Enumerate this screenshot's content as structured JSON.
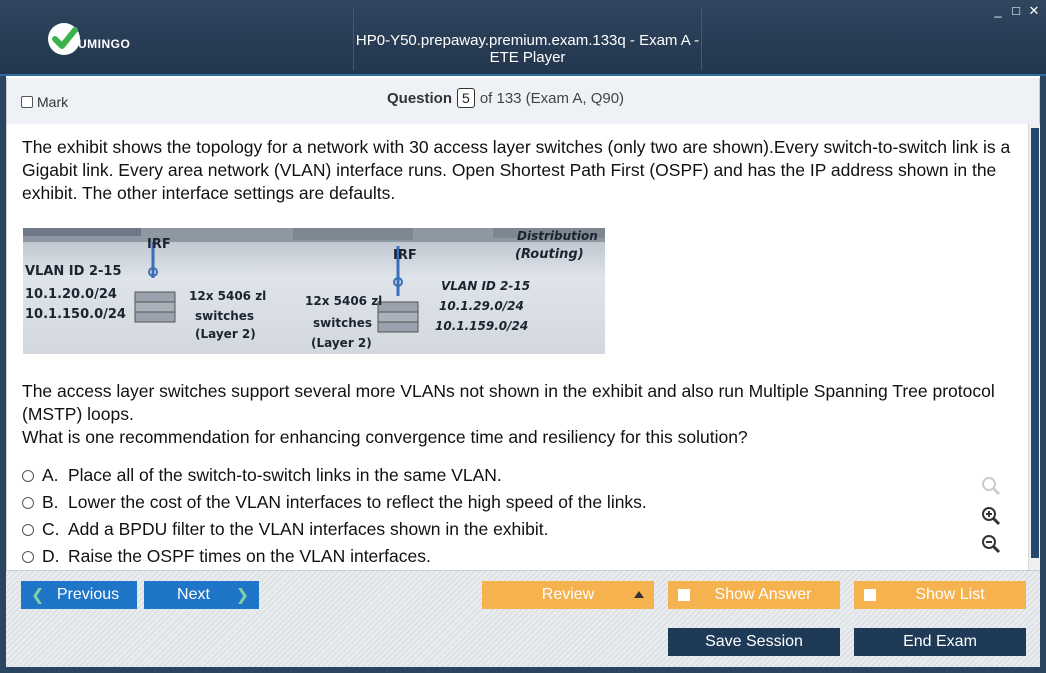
{
  "window": {
    "title": "HP0-Y50.prepaway.premium.exam.133q - Exam A - ETE Player",
    "logo_text": "UMINGO",
    "controls": {
      "minimize": "_",
      "maximize": "□",
      "close": "✕"
    }
  },
  "header": {
    "mark_label": "Mark",
    "question_label": "Question",
    "question_number": "5",
    "of_text": "of 133 (Exam A, Q90)"
  },
  "question": {
    "intro": "The exhibit shows the topology for a network with 30 access layer switches (only two are shown).Every switch-to-switch link is a Gigabit link. Every area network (VLAN) interface runs. Open Shortest Path First (OSPF) and has the IP address shown in the exhibit. The other interface settings are defaults.",
    "followup_1": "The access layer switches support several more VLANs not shown in the exhibit and also run Multiple Spanning Tree protocol (MSTP) loops.",
    "followup_2": "What is one recommendation for enhancing convergence time and resiliency for this solution?"
  },
  "exhibit": {
    "irf_left": "IRF",
    "irf_right": "IRF",
    "distribution": "Distribution",
    "routing": "(Routing)",
    "left_vlan": "VLAN ID 2-15",
    "left_net1": "10.1.20.0/24",
    "left_net2": "10.1.150.0/24",
    "left_sw1": "12x 5406 zl",
    "left_sw2": "switches",
    "left_sw3": "(Layer 2)",
    "mid_sw1": "12x 5406 zl",
    "mid_sw2": "switches",
    "mid_sw3": "(Layer 2)",
    "right_vlan": "VLAN ID 2-15",
    "right_net1": "10.1.29.0/24",
    "right_net2": "10.1.159.0/24"
  },
  "answers": [
    {
      "letter": "A.",
      "text": "Place all of the switch-to-switch links in the same VLAN."
    },
    {
      "letter": "B.",
      "text": "Lower the cost of the VLAN interfaces to reflect the high speed of the links."
    },
    {
      "letter": "C.",
      "text": "Add a BPDU filter to the VLAN interfaces shown in the exhibit."
    },
    {
      "letter": "D.",
      "text": "Raise the OSPF times on the VLAN interfaces."
    }
  ],
  "toolbar": {
    "previous": "Previous",
    "next": "Next",
    "review": "Review",
    "show_answer": "Show Answer",
    "show_list": "Show List",
    "save_session": "Save Session",
    "end_exam": "End Exam"
  },
  "colors": {
    "title_bar": "#22364d",
    "nav_button": "#1f75c8",
    "option_button": "#f7b250",
    "session_button": "#1f3a56"
  }
}
